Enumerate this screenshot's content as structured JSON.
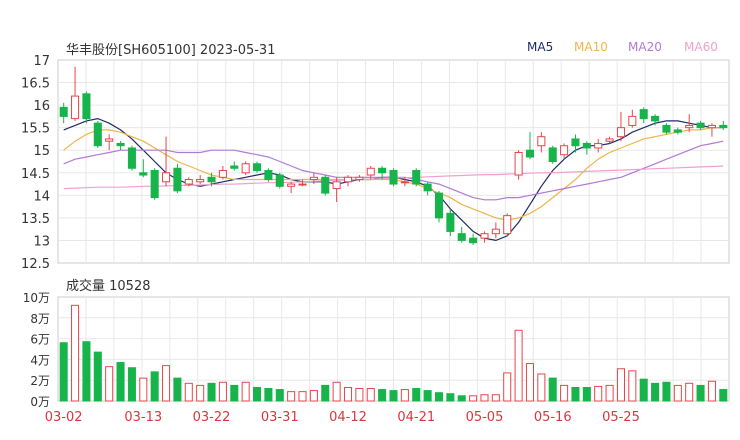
{
  "header": {
    "title": "华丰股份[SH605100] 2023-05-31",
    "legend": [
      {
        "name": "MA5",
        "color": "#1f2a6b"
      },
      {
        "name": "MA10",
        "color": "#f0b448"
      },
      {
        "name": "MA20",
        "color": "#b07ad6"
      },
      {
        "name": "MA60",
        "color": "#f0a0d0"
      }
    ],
    "volume_label": "成交量 10528"
  },
  "colors": {
    "up": "#e8454a",
    "down": "#16b44a",
    "grid": "#e8e8e8",
    "axis_text": "#333333",
    "date_text": "#d9363e"
  },
  "chart_data": [
    {
      "type": "candlestick",
      "title": "",
      "ylim": [
        12.5,
        17
      ],
      "y_ticks": [
        "17",
        "16.5",
        "16",
        "15.5",
        "15",
        "14.5",
        "14",
        "13.5",
        "13",
        "12.5"
      ],
      "x_tick_labels": [
        "03-02",
        "03-13",
        "03-22",
        "03-31",
        "04-12",
        "04-21",
        "05-05",
        "05-16",
        "05-25"
      ],
      "x_tick_index": [
        0,
        7,
        13,
        19,
        25,
        31,
        37,
        43,
        49
      ],
      "candles": [
        [
          15.95,
          15.75,
          16.05,
          15.6
        ],
        [
          15.7,
          16.2,
          16.85,
          15.65
        ],
        [
          16.25,
          15.7,
          16.3,
          15.6
        ],
        [
          15.6,
          15.1,
          15.65,
          15.05
        ],
        [
          15.2,
          15.25,
          15.35,
          15.0
        ],
        [
          15.15,
          15.1,
          15.2,
          15.0
        ],
        [
          15.05,
          14.6,
          15.1,
          14.55
        ],
        [
          14.5,
          14.45,
          14.8,
          14.4
        ],
        [
          14.55,
          13.95,
          14.6,
          13.9
        ],
        [
          14.3,
          14.5,
          15.3,
          14.2
        ],
        [
          14.6,
          14.1,
          14.7,
          14.05
        ],
        [
          14.25,
          14.35,
          14.4,
          14.2
        ],
        [
          14.3,
          14.35,
          14.45,
          14.25
        ],
        [
          14.4,
          14.3,
          14.5,
          14.2
        ],
        [
          14.4,
          14.55,
          14.65,
          14.35
        ],
        [
          14.65,
          14.6,
          14.75,
          14.55
        ],
        [
          14.5,
          14.7,
          14.75,
          14.45
        ],
        [
          14.7,
          14.55,
          14.75,
          14.5
        ],
        [
          14.55,
          14.35,
          14.6,
          14.3
        ],
        [
          14.45,
          14.2,
          14.5,
          14.15
        ],
        [
          14.2,
          14.25,
          14.3,
          14.05
        ],
        [
          14.25,
          14.25,
          14.35,
          14.2
        ],
        [
          14.35,
          14.4,
          14.5,
          14.25
        ],
        [
          14.4,
          14.05,
          14.45,
          14.0
        ],
        [
          14.15,
          14.3,
          14.4,
          13.85
        ],
        [
          14.3,
          14.4,
          14.45,
          14.2
        ],
        [
          14.35,
          14.4,
          14.45,
          14.3
        ],
        [
          14.45,
          14.6,
          14.65,
          14.35
        ],
        [
          14.6,
          14.5,
          14.65,
          14.35
        ],
        [
          14.55,
          14.25,
          14.6,
          14.2
        ],
        [
          14.3,
          14.3,
          14.4,
          14.2
        ],
        [
          14.55,
          14.25,
          14.6,
          14.2
        ],
        [
          14.25,
          14.1,
          14.3,
          14.0
        ],
        [
          14.05,
          13.5,
          14.1,
          13.4
        ],
        [
          13.6,
          13.2,
          13.7,
          13.1
        ],
        [
          13.15,
          13.0,
          13.3,
          12.95
        ],
        [
          13.05,
          12.95,
          13.15,
          12.9
        ],
        [
          13.05,
          13.15,
          13.2,
          12.95
        ],
        [
          13.15,
          13.25,
          13.4,
          13.05
        ],
        [
          13.15,
          13.55,
          13.6,
          13.1
        ],
        [
          14.45,
          14.95,
          15.0,
          14.35
        ],
        [
          15.0,
          14.85,
          15.4,
          14.8
        ],
        [
          15.1,
          15.3,
          15.4,
          14.95
        ],
        [
          15.05,
          14.75,
          15.1,
          14.7
        ],
        [
          14.9,
          15.1,
          15.15,
          14.8
        ],
        [
          15.25,
          15.1,
          15.35,
          14.95
        ],
        [
          15.15,
          15.05,
          15.2,
          14.9
        ],
        [
          15.05,
          15.15,
          15.25,
          14.95
        ],
        [
          15.2,
          15.25,
          15.3,
          15.15
        ],
        [
          15.3,
          15.5,
          15.85,
          15.2
        ],
        [
          15.55,
          15.75,
          15.9,
          15.5
        ],
        [
          15.9,
          15.7,
          15.95,
          15.6
        ],
        [
          15.75,
          15.65,
          15.8,
          15.55
        ],
        [
          15.55,
          15.4,
          15.6,
          15.35
        ],
        [
          15.45,
          15.4,
          15.5,
          15.35
        ],
        [
          15.5,
          15.55,
          15.8,
          15.4
        ],
        [
          15.6,
          15.5,
          15.65,
          15.45
        ],
        [
          15.5,
          15.55,
          15.6,
          15.3
        ],
        [
          15.55,
          15.5,
          15.65,
          15.45
        ]
      ],
      "series": [
        {
          "name": "MA5",
          "color": "#1f2a6b",
          "values": [
            15.45,
            15.55,
            15.65,
            15.7,
            15.6,
            15.45,
            15.25,
            15.0,
            14.75,
            14.5,
            14.35,
            14.25,
            14.2,
            14.25,
            14.3,
            14.35,
            14.4,
            14.45,
            14.5,
            14.45,
            14.35,
            14.3,
            14.3,
            14.3,
            14.25,
            14.3,
            14.35,
            14.35,
            14.4,
            14.4,
            14.35,
            14.3,
            14.2,
            14.0,
            13.7,
            13.45,
            13.2,
            13.05,
            13.0,
            13.1,
            13.4,
            13.8,
            14.2,
            14.55,
            14.8,
            15.0,
            15.1,
            15.1,
            15.15,
            15.25,
            15.4,
            15.5,
            15.6,
            15.65,
            15.65,
            15.6,
            15.55,
            15.5,
            15.5
          ]
        },
        {
          "name": "MA10",
          "color": "#f0b448",
          "values": [
            15.0,
            15.2,
            15.35,
            15.45,
            15.45,
            15.4,
            15.3,
            15.2,
            15.05,
            14.9,
            14.75,
            14.65,
            14.55,
            14.45,
            14.4,
            14.35,
            14.35,
            14.35,
            14.35,
            14.35,
            14.35,
            14.35,
            14.35,
            14.35,
            14.35,
            14.35,
            14.35,
            14.35,
            14.35,
            14.35,
            14.3,
            14.25,
            14.15,
            14.05,
            13.95,
            13.8,
            13.7,
            13.6,
            13.5,
            13.45,
            13.5,
            13.6,
            13.75,
            13.95,
            14.15,
            14.35,
            14.6,
            14.8,
            14.95,
            15.05,
            15.15,
            15.25,
            15.3,
            15.35,
            15.4,
            15.45,
            15.45,
            15.5,
            15.5
          ]
        },
        {
          "name": "MA20",
          "color": "#b07ad6",
          "values": [
            14.7,
            14.8,
            14.85,
            14.9,
            14.95,
            15.0,
            15.0,
            15.0,
            15.0,
            15.0,
            14.95,
            14.95,
            14.95,
            15.0,
            15.0,
            15.0,
            14.95,
            14.9,
            14.85,
            14.75,
            14.65,
            14.55,
            14.5,
            14.45,
            14.4,
            14.4,
            14.4,
            14.4,
            14.4,
            14.4,
            14.4,
            14.35,
            14.3,
            14.25,
            14.15,
            14.05,
            13.95,
            13.9,
            13.9,
            13.95,
            13.95,
            14.0,
            14.05,
            14.1,
            14.15,
            14.2,
            14.25,
            14.3,
            14.35,
            14.4,
            14.5,
            14.6,
            14.7,
            14.8,
            14.9,
            15.0,
            15.1,
            15.15,
            15.2
          ]
        },
        {
          "name": "MA60",
          "color": "#f0a0d0",
          "values": [
            14.15,
            14.16,
            14.17,
            14.18,
            14.18,
            14.18,
            14.19,
            14.2,
            14.2,
            14.21,
            14.22,
            14.22,
            14.23,
            14.24,
            14.25,
            14.25,
            14.26,
            14.27,
            14.28,
            14.28,
            14.29,
            14.3,
            14.31,
            14.32,
            14.33,
            14.34,
            14.35,
            14.36,
            14.37,
            14.38,
            14.39,
            14.4,
            14.41,
            14.42,
            14.43,
            14.44,
            14.45,
            14.46,
            14.46,
            14.47,
            14.48,
            14.49,
            14.5,
            14.5,
            14.51,
            14.52,
            14.53,
            14.54,
            14.55,
            14.56,
            14.57,
            14.58,
            14.59,
            14.6,
            14.61,
            14.62,
            14.63,
            14.64,
            14.65
          ]
        }
      ]
    },
    {
      "type": "bar",
      "title": "成交量",
      "unit": "万",
      "ylim": [
        0,
        100000
      ],
      "y_ticks": [
        "10万",
        "8万",
        "6万",
        "4万",
        "2万",
        "0万"
      ],
      "y_tick_values": [
        100000,
        80000,
        60000,
        40000,
        20000,
        0
      ],
      "values": [
        56000,
        92000,
        57000,
        47000,
        33000,
        37000,
        32000,
        22000,
        28000,
        34000,
        22000,
        17000,
        15000,
        17000,
        18000,
        15000,
        18000,
        13000,
        12000,
        11000,
        9000,
        9000,
        10000,
        15000,
        18000,
        13000,
        12000,
        12000,
        11000,
        10000,
        11000,
        12000,
        10000,
        8000,
        7000,
        5000,
        5000,
        6000,
        6000,
        27000,
        68000,
        36000,
        26000,
        22000,
        15000,
        13000,
        13000,
        14000,
        15000,
        31000,
        29000,
        21000,
        17000,
        18000,
        15000,
        17000,
        15000,
        19000,
        11000
      ],
      "up_flags": [
        0,
        1,
        0,
        0,
        1,
        0,
        0,
        1,
        0,
        1,
        0,
        1,
        1,
        0,
        1,
        0,
        1,
        0,
        0,
        0,
        1,
        1,
        1,
        0,
        1,
        1,
        1,
        1,
        0,
        0,
        1,
        0,
        0,
        0,
        0,
        0,
        1,
        1,
        1,
        1,
        1,
        1,
        1,
        0,
        1,
        0,
        0,
        1,
        1,
        1,
        1,
        0,
        0,
        0,
        1,
        1,
        0,
        1,
        0
      ]
    }
  ]
}
